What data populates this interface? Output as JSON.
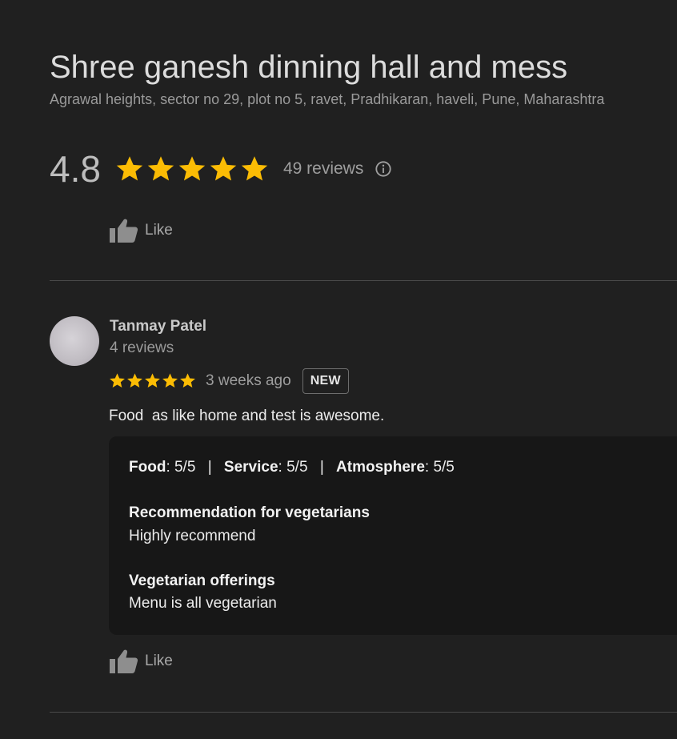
{
  "place": {
    "name": "Shree ganesh dinning hall and mess",
    "address": "Agrawal heights, sector no 29, plot no 5, ravet, Pradhikaran, haveli, Pune, Maharashtra",
    "rating": "4.8",
    "rating_stars": 5,
    "reviews_label": "49 reviews",
    "like_label": "Like",
    "info_icon": "info-icon"
  },
  "review": {
    "author": "Tanmay Patel",
    "author_reviews": "4 reviews",
    "stars": 5,
    "time_ago": "3 weeks ago",
    "badge": "NEW",
    "text": "Food  as like home and test is awesome.",
    "attributes": [
      {
        "label": "Food",
        "value": ": 5/5"
      },
      {
        "label": "Service",
        "value": ": 5/5"
      },
      {
        "label": "Atmosphere",
        "value": ": 5/5"
      }
    ],
    "separator": "|",
    "questions": [
      {
        "title": "Recommendation for vegetarians",
        "answer": "Highly recommend"
      },
      {
        "title": "Vegetarian offerings",
        "answer": "Menu is all vegetarian"
      }
    ],
    "like_label": "Like"
  },
  "colors": {
    "background": "#202020",
    "star": "#fbbc04",
    "details_bg": "#171717"
  }
}
